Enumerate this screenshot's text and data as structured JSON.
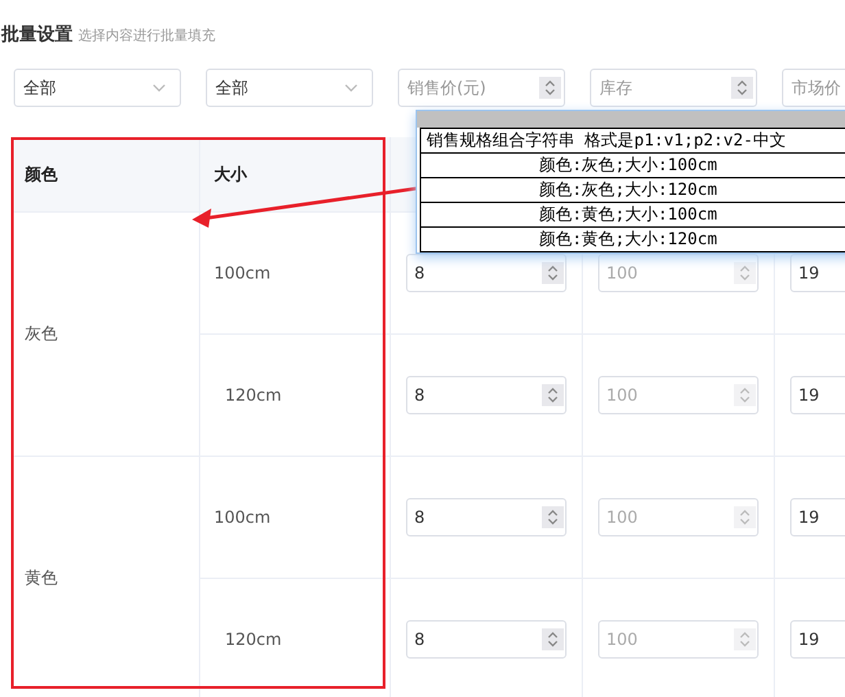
{
  "header": {
    "title": "批量设置",
    "hint": "选择内容进行批量填充"
  },
  "filters": [
    {
      "kind": "select",
      "value": "全部"
    },
    {
      "kind": "select",
      "value": "全部"
    },
    {
      "kind": "number",
      "placeholder": "销售价(元)"
    },
    {
      "kind": "number",
      "placeholder": "库存"
    },
    {
      "kind": "number",
      "placeholder": "市场价"
    }
  ],
  "table": {
    "columns": [
      "颜色",
      "大小"
    ],
    "groups": [
      {
        "name": "灰色",
        "rows": [
          {
            "size": "100cm",
            "cells": [
              {
                "value": "8",
                "disabled": false
              },
              {
                "value": "100",
                "disabled": true
              },
              {
                "value": "19",
                "disabled": false
              }
            ]
          },
          {
            "size": "120cm",
            "cells": [
              {
                "value": "8",
                "disabled": false
              },
              {
                "value": "100",
                "disabled": true
              },
              {
                "value": "19",
                "disabled": false
              }
            ]
          }
        ]
      },
      {
        "name": "黄色",
        "rows": [
          {
            "size": "100cm",
            "cells": [
              {
                "value": "8",
                "disabled": false
              },
              {
                "value": "100",
                "disabled": true
              },
              {
                "value": "19",
                "disabled": false
              }
            ]
          },
          {
            "size": "120cm",
            "cells": [
              {
                "value": "8",
                "disabled": false
              },
              {
                "value": "100",
                "disabled": true
              },
              {
                "value": "19",
                "disabled": false
              }
            ]
          }
        ]
      }
    ]
  },
  "popup": {
    "heading": "销售规格组合字符串 格式是p1:v1;p2:v2-中文",
    "rows": [
      "颜色:灰色;大小:100cm",
      "颜色:灰色;大小:120cm",
      "颜色:黄色;大小:100cm",
      "颜色:黄色;大小:120cm"
    ]
  }
}
